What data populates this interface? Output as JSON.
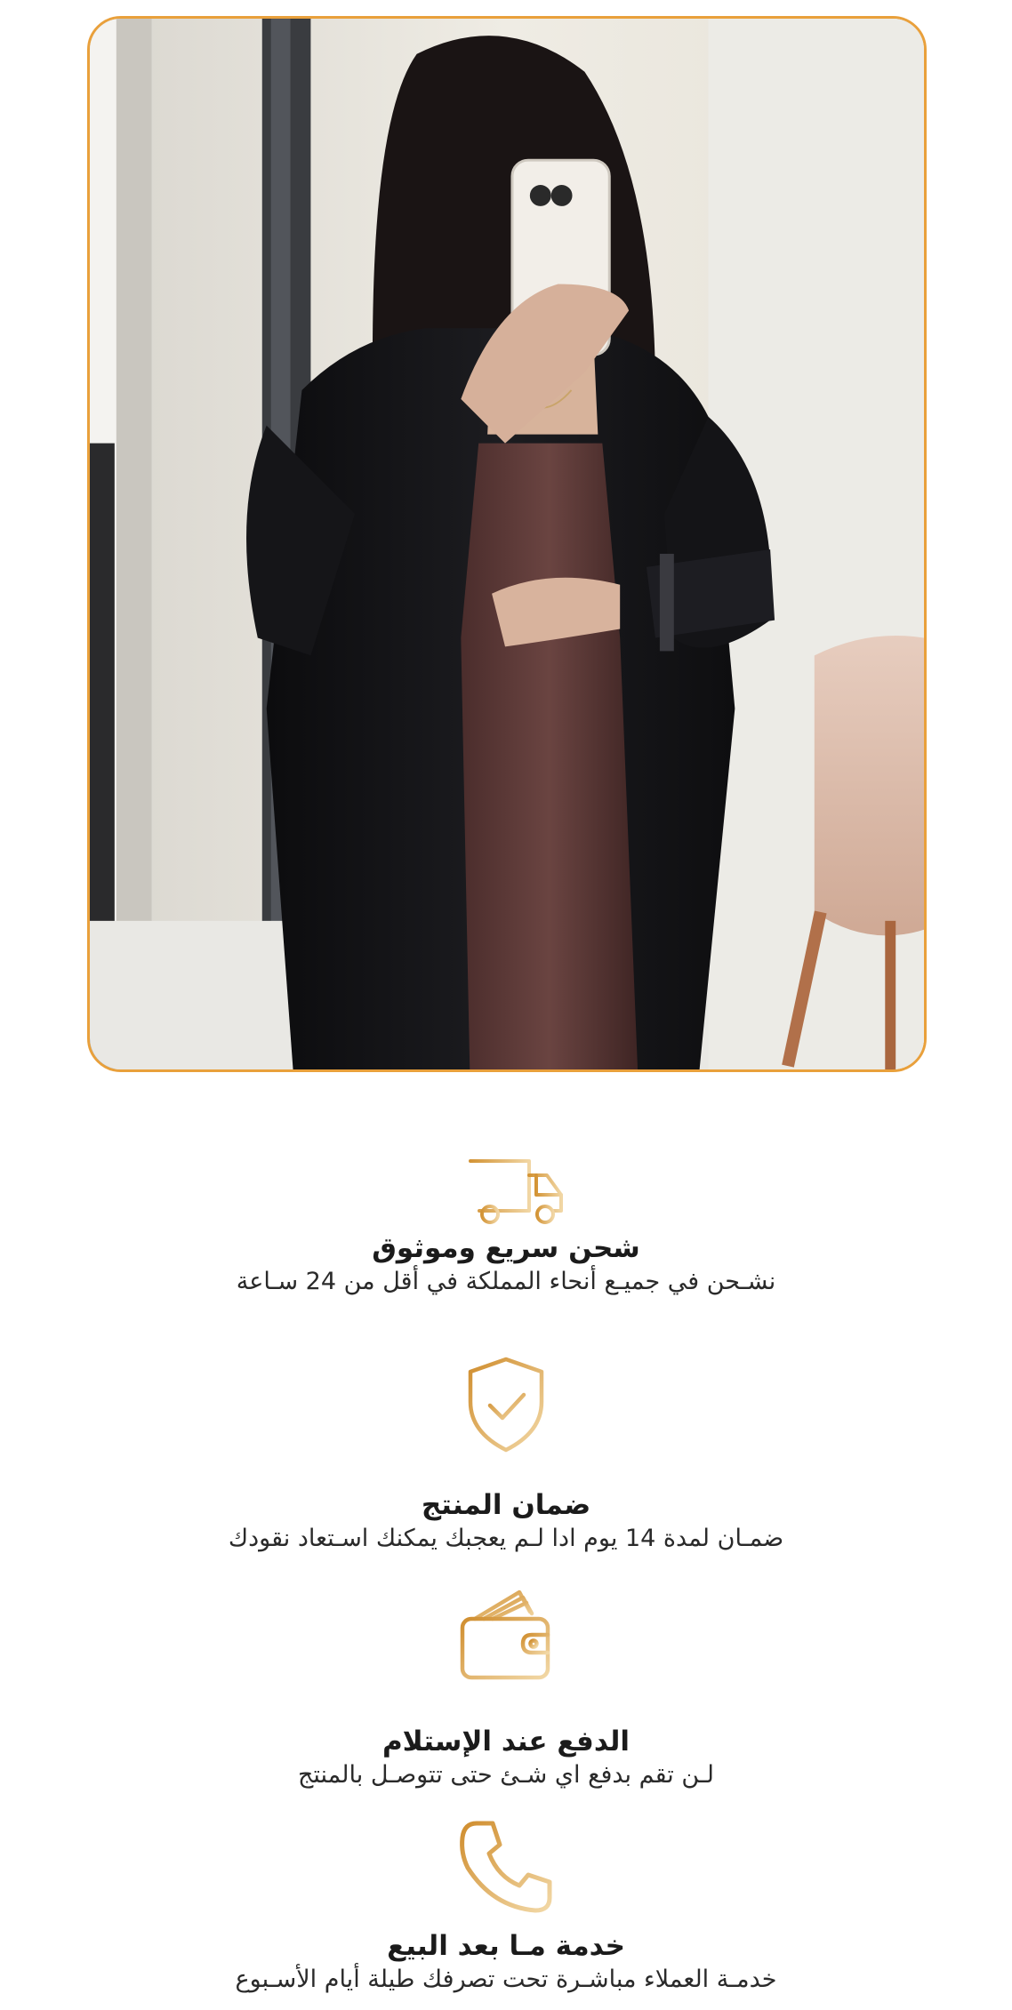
{
  "colors": {
    "accent": "#e9a03b",
    "icon_gold_dark": "#c98a2b",
    "icon_gold_light": "#f3d9a6",
    "text": "#1b1b1b"
  },
  "product_photo": {
    "alt": "Black abaya worn over a brown dress, mirror selfie"
  },
  "features": [
    {
      "icon": "delivery-truck-icon",
      "title": "شحن سريع وموثوق",
      "description": "نشـحن في جميـع أنحاء المملكة في أقل من 24 سـاعة"
    },
    {
      "icon": "shield-check-icon",
      "title": "ضمان المنتج",
      "description": "ضمـان لمدة 14 يوم ادا لـم يعجبك يمكنك اسـتعاد نقودك"
    },
    {
      "icon": "wallet-icon",
      "title": "الدفع عند الإستلام",
      "description": "لـن تقم بدفع اي شـئ حتى تتوصـل بالمنتج"
    },
    {
      "icon": "phone-icon",
      "title": "خدمة مـا بعد البيع",
      "description": "خدمـة العملاء مباشـرة تحت تصرفك طيلة أيام الأسـبوع"
    }
  ]
}
